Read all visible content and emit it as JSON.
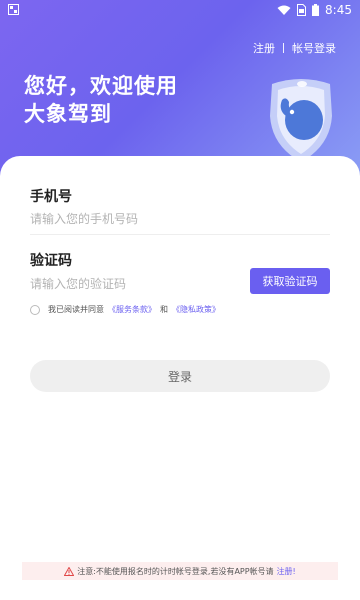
{
  "status_bar": {
    "time": "8:45"
  },
  "header": {
    "register_label": "注册",
    "account_login_label": "帐号登录",
    "welcome_line1": "您好，欢迎使用",
    "welcome_line2": "大象驾到"
  },
  "form": {
    "phone_label": "手机号",
    "phone_placeholder": "请输入您的手机号码",
    "code_label": "验证码",
    "code_placeholder": "请输入您的验证码",
    "get_code_label": "获取验证码"
  },
  "agreement": {
    "prefix": "我已阅读并同意",
    "terms": "《服务条款》",
    "and": "和",
    "privacy": "《隐私政策》"
  },
  "login_button": "登录",
  "notice": {
    "text": "注意:不能使用报名时的计时帐号登录,若没有APP帐号请",
    "link": "注册!"
  },
  "colors": {
    "accent": "#6a5ff0",
    "hero_start": "#7d66f0",
    "hero_end": "#8da2f5"
  }
}
